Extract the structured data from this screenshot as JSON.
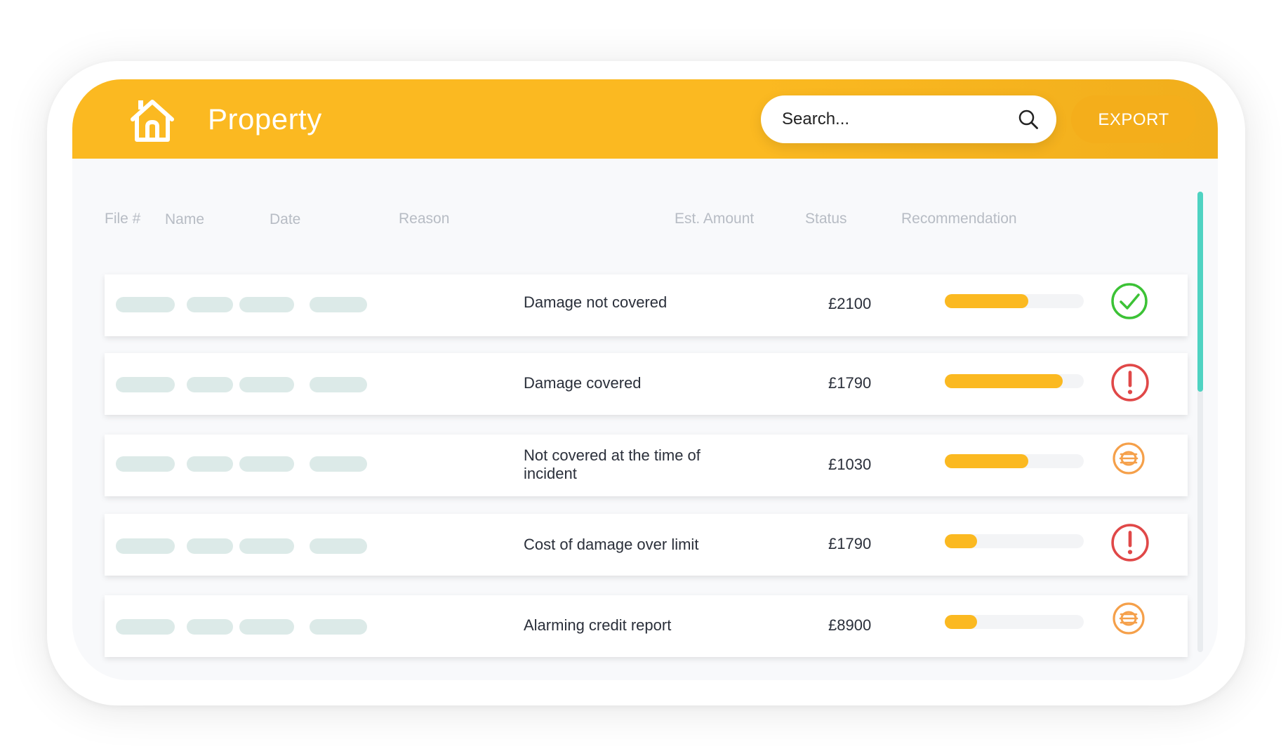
{
  "header": {
    "title": "Property",
    "search_placeholder": "Search...",
    "export_label": "EXPORT"
  },
  "columns": {
    "file": "File #",
    "name": "Name",
    "date": "Date",
    "reason": "Reason",
    "amount": "Est. Amount",
    "status": "Status",
    "recommendation": "Recommendation"
  },
  "rows": [
    {
      "reason": "Damage not covered",
      "amount": "£2100",
      "status_progress": 0.6,
      "recommendation": "approve-check-icon"
    },
    {
      "reason": "Damage covered",
      "amount": "£1790",
      "status_progress": 0.85,
      "recommendation": "warning-exclamation-icon"
    },
    {
      "reason": "Not covered at the time of incident",
      "amount": "£1030",
      "status_progress": 0.6,
      "recommendation": "review-money-icon"
    },
    {
      "reason": "Cost of damage over limit",
      "amount": "£1790",
      "status_progress": 0.23,
      "recommendation": "warning-exclamation-icon"
    },
    {
      "reason": "Alarming credit report",
      "amount": "£8900",
      "status_progress": 0.23,
      "recommendation": "review-money-icon"
    }
  ],
  "colors": {
    "accent": "#fbb921",
    "scrollbar": "#4fd3c2",
    "approve": "#3cc236",
    "warning": "#e04848",
    "review": "#f5a04a"
  }
}
